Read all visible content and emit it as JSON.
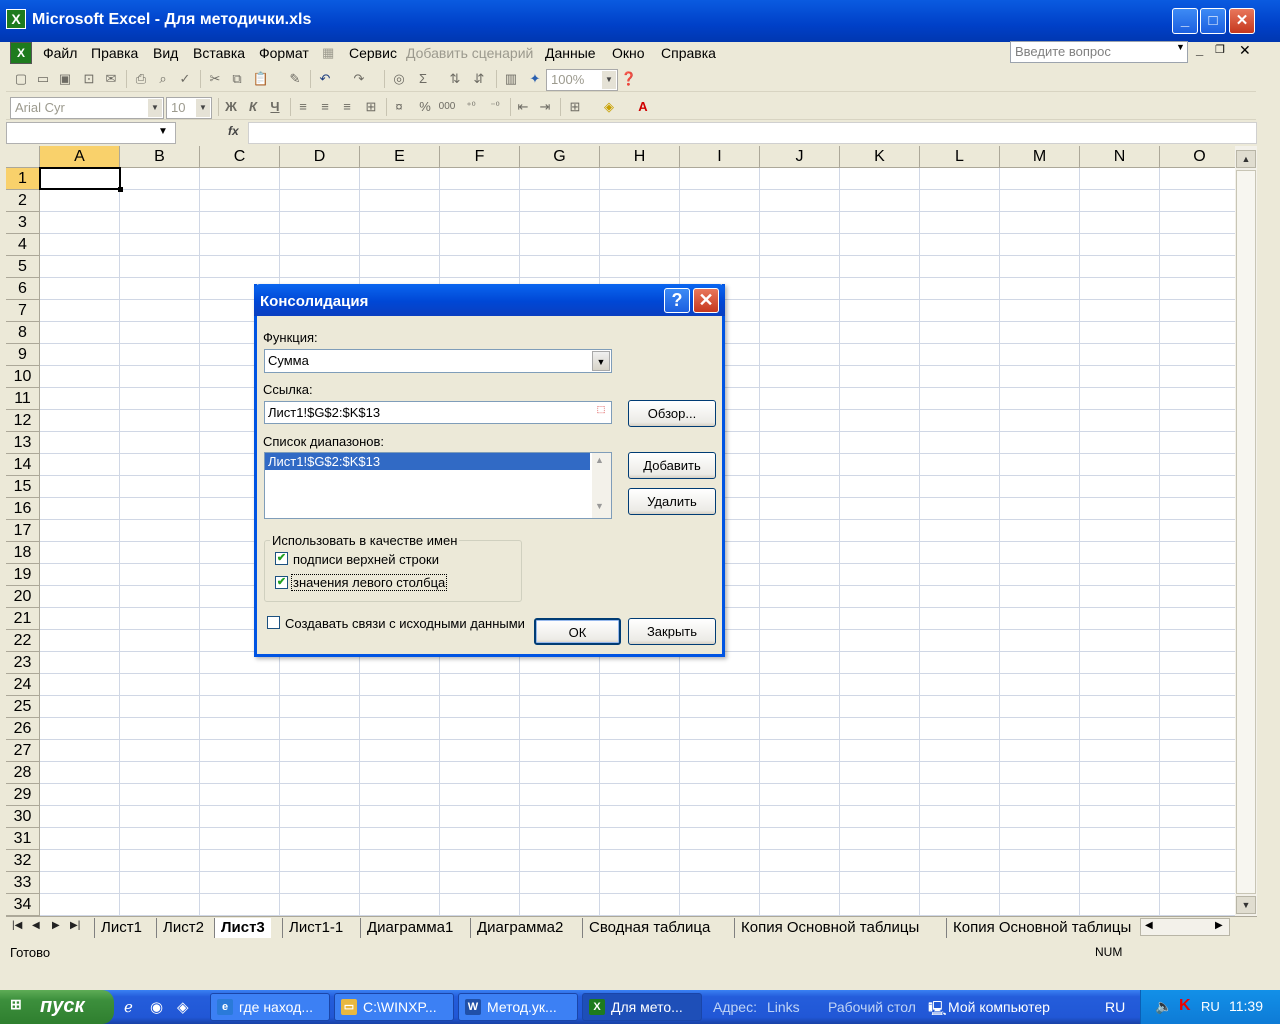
{
  "window": {
    "title": "Microsoft Excel - Для методички.xls",
    "min": "_",
    "max": "□",
    "close": "✕"
  },
  "menu": [
    {
      "label": "Файл"
    },
    {
      "label": "Правка"
    },
    {
      "label": "Вид"
    },
    {
      "label": "Вставка"
    },
    {
      "label": "Формат"
    },
    {
      "label": "Сервис"
    },
    {
      "label": "Добавить сценарий"
    },
    {
      "label": "Данные"
    },
    {
      "label": "Окно"
    },
    {
      "label": "Справка"
    }
  ],
  "ask": {
    "placeholder": "Введите вопрос"
  },
  "toolbar": {
    "zoom": "100%",
    "font": "Arial Cyr",
    "size": "10",
    "bold": "Ж",
    "italic": "К",
    "underline": "Ч",
    "percent": "%",
    "thousands": "000"
  },
  "formula": {
    "fx": "fx"
  },
  "columns": [
    "A",
    "B",
    "C",
    "D",
    "E",
    "F",
    "G",
    "H",
    "I",
    "J",
    "K",
    "L",
    "M",
    "N",
    "O"
  ],
  "rows": [
    "1",
    "2",
    "3",
    "4",
    "5",
    "6",
    "7",
    "8",
    "9",
    "10",
    "11",
    "12",
    "13",
    "14",
    "15",
    "16",
    "17",
    "18",
    "19",
    "20",
    "21",
    "22",
    "23",
    "24",
    "25",
    "26",
    "27",
    "28",
    "29",
    "30",
    "31",
    "32",
    "33",
    "34"
  ],
  "dialog": {
    "title": "Консолидация",
    "help": "?",
    "close": "✕",
    "function_label": "Функция:",
    "function_value": "Сумма",
    "ref_label": "Ссылка:",
    "ref_value": "Лист1!$G$2:$K$13",
    "browse": "Обзор...",
    "ranges_label": "Список диапазонов:",
    "ranges": [
      "Лист1!$G$2:$K$13"
    ],
    "add": "Добавить",
    "delete": "Удалить",
    "use_names_label": "Использовать в качестве имен",
    "top_row": "подписи верхней строки",
    "left_col": "значения левого столбца",
    "links": "Создавать связи с исходными данными",
    "ok": "ОК",
    "cancel": "Закрыть",
    "top_row_checked": true,
    "left_col_checked": true,
    "links_checked": false
  },
  "tabs": [
    {
      "label": "Лист1"
    },
    {
      "label": "Лист2"
    },
    {
      "label": "Лист3"
    },
    {
      "label": "Лист1-1"
    },
    {
      "label": "Диаграмма1"
    },
    {
      "label": "Диаграмма2"
    },
    {
      "label": "Сводная таблица"
    },
    {
      "label": "Копия Основной таблицы"
    },
    {
      "label": "Копия Основной таблицы"
    }
  ],
  "active_tab": "Лист3",
  "status": {
    "text": "Готово",
    "num": "NUM"
  },
  "taskbar": {
    "start": "пуск",
    "tasks": [
      {
        "label": "где наход..."
      },
      {
        "label": "C:\\WINXP..."
      },
      {
        "label": "Метод.ук..."
      },
      {
        "label": "Для мето..."
      }
    ],
    "address": "Адрес:",
    "links": "Links",
    "desktop": "Рабочий стол",
    "mycomputer": "Мой компьютер",
    "lang": "RU",
    "tray_lang": "RU",
    "clock": "11:39"
  }
}
